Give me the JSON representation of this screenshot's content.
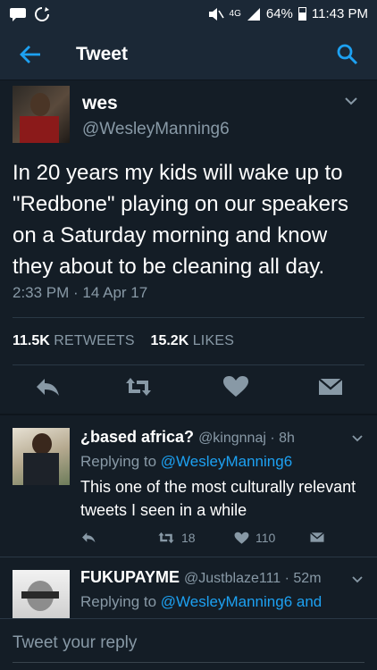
{
  "status_bar": {
    "network": "4G",
    "battery": "64%",
    "time": "11:43 PM"
  },
  "app_bar": {
    "title": "Tweet"
  },
  "main_tweet": {
    "name": "wes",
    "handle": "@WesleyManning6",
    "text": "In 20 years my kids will wake up to \"Redbone\" playing on our speakers on a Saturday morning and know they about to be cleaning all day.",
    "timestamp": "2:33 PM · 14 Apr 17",
    "retweets_count": "11.5K",
    "retweets_label": "RETWEETS",
    "likes_count": "15.2K",
    "likes_label": "LIKES"
  },
  "replies": [
    {
      "name": "¿based africa?",
      "handle": "@kingnnaj · 8h",
      "replying_prefix": "Replying to",
      "replying_to": "@WesleyManning6",
      "text": "This one of the most culturally relevant tweets I seen in a while",
      "retweets": "18",
      "likes": "110"
    },
    {
      "name": "FUKUPAYME",
      "handle": "@Justblaze111 · 52m",
      "replying_prefix": "Replying to",
      "replying_to": "@WesleyManning6 and"
    }
  ],
  "reply_bar": {
    "placeholder": "Tweet your reply"
  },
  "colors": {
    "background": "#141d26",
    "bar": "#1b2836",
    "accent": "#1da1f2",
    "muted": "#8899a6"
  }
}
